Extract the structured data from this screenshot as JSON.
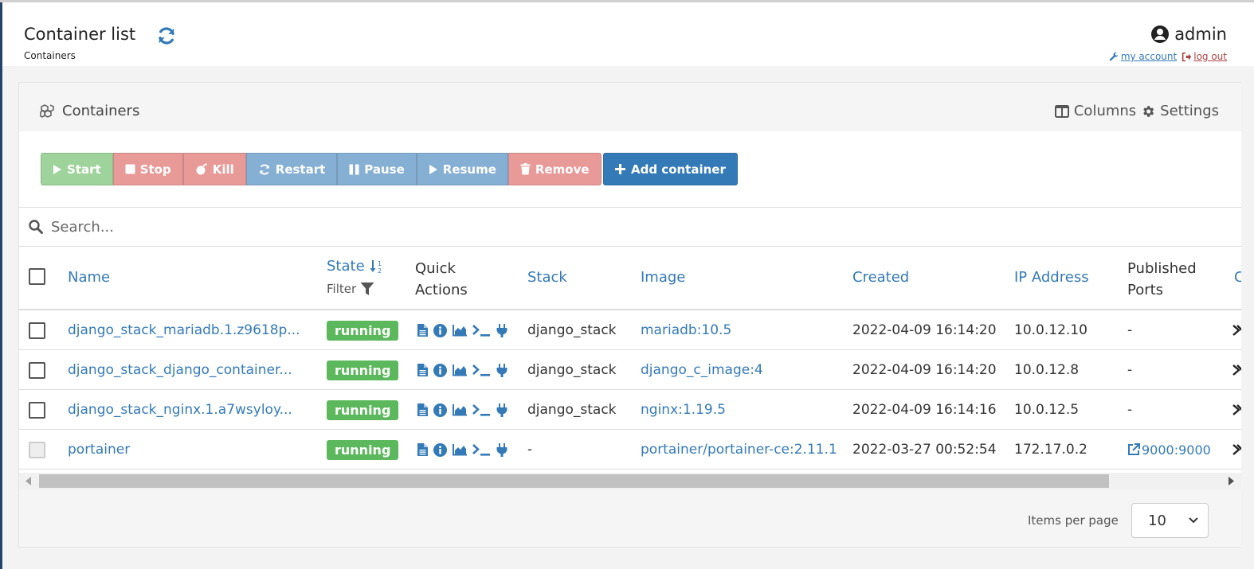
{
  "header": {
    "title": "Container list",
    "breadcrumb": "Containers",
    "username": "admin",
    "my_account": "my account",
    "log_out": "log out"
  },
  "widget": {
    "title": "Containers",
    "columns_label": "Columns",
    "settings_label": "Settings"
  },
  "actions": {
    "start": "Start",
    "stop": "Stop",
    "kill": "Kill",
    "restart": "Restart",
    "pause": "Pause",
    "resume": "Resume",
    "remove": "Remove",
    "add_container": "Add container"
  },
  "search": {
    "placeholder": "Search..."
  },
  "table": {
    "headers": {
      "name": "Name",
      "state": "State",
      "state_filter": "Filter",
      "quick_actions": "Quick Actions",
      "stack": "Stack",
      "image": "Image",
      "created": "Created",
      "ip_address": "IP Address",
      "published_ports": "Published Ports",
      "cut_off": "C"
    },
    "rows": [
      {
        "name": "django_stack_mariadb.1.z9618p...",
        "state": "running",
        "stack": "django_stack",
        "image": "mariadb:10.5",
        "created": "2022-04-09 16:14:20",
        "ip": "10.0.12.10",
        "ports": "-"
      },
      {
        "name": "django_stack_django_container...",
        "state": "running",
        "stack": "django_stack",
        "image": "django_c_image:4",
        "created": "2022-04-09 16:14:20",
        "ip": "10.0.12.8",
        "ports": "-"
      },
      {
        "name": "django_stack_nginx.1.a7wsyloy...",
        "state": "running",
        "stack": "django_stack",
        "image": "nginx:1.19.5",
        "created": "2022-04-09 16:14:16",
        "ip": "10.0.12.5",
        "ports": "-"
      },
      {
        "name": "portainer",
        "state": "running",
        "stack": "-",
        "image": "portainer/portainer-ce:2.11.1",
        "created": "2022-03-27 00:52:54",
        "ip": "172.17.0.2",
        "ports": "9000:9000"
      }
    ]
  },
  "footer": {
    "items_per_page_label": "Items per page",
    "items_per_page_value": "10"
  },
  "colors": {
    "primary": "#337ab7",
    "success": "#5cb85c",
    "danger_light": "#e89a98",
    "info_light": "#86afd4",
    "success_light": "#9ed49b"
  },
  "icons": {
    "refresh": "refresh-icon",
    "user": "user-circle-icon",
    "wrench": "wrench-icon",
    "sign_out": "sign-out-icon",
    "cubes": "cubes-icon",
    "columns": "columns-icon",
    "gear": "gear-icon",
    "search": "search-icon",
    "sort": "sort-numeric-icon",
    "filter": "filter-icon",
    "quick_actions": [
      "logs-icon",
      "inspect-icon",
      "stats-icon",
      "console-icon",
      "attach-icon"
    ],
    "external_link": "external-link-icon"
  }
}
